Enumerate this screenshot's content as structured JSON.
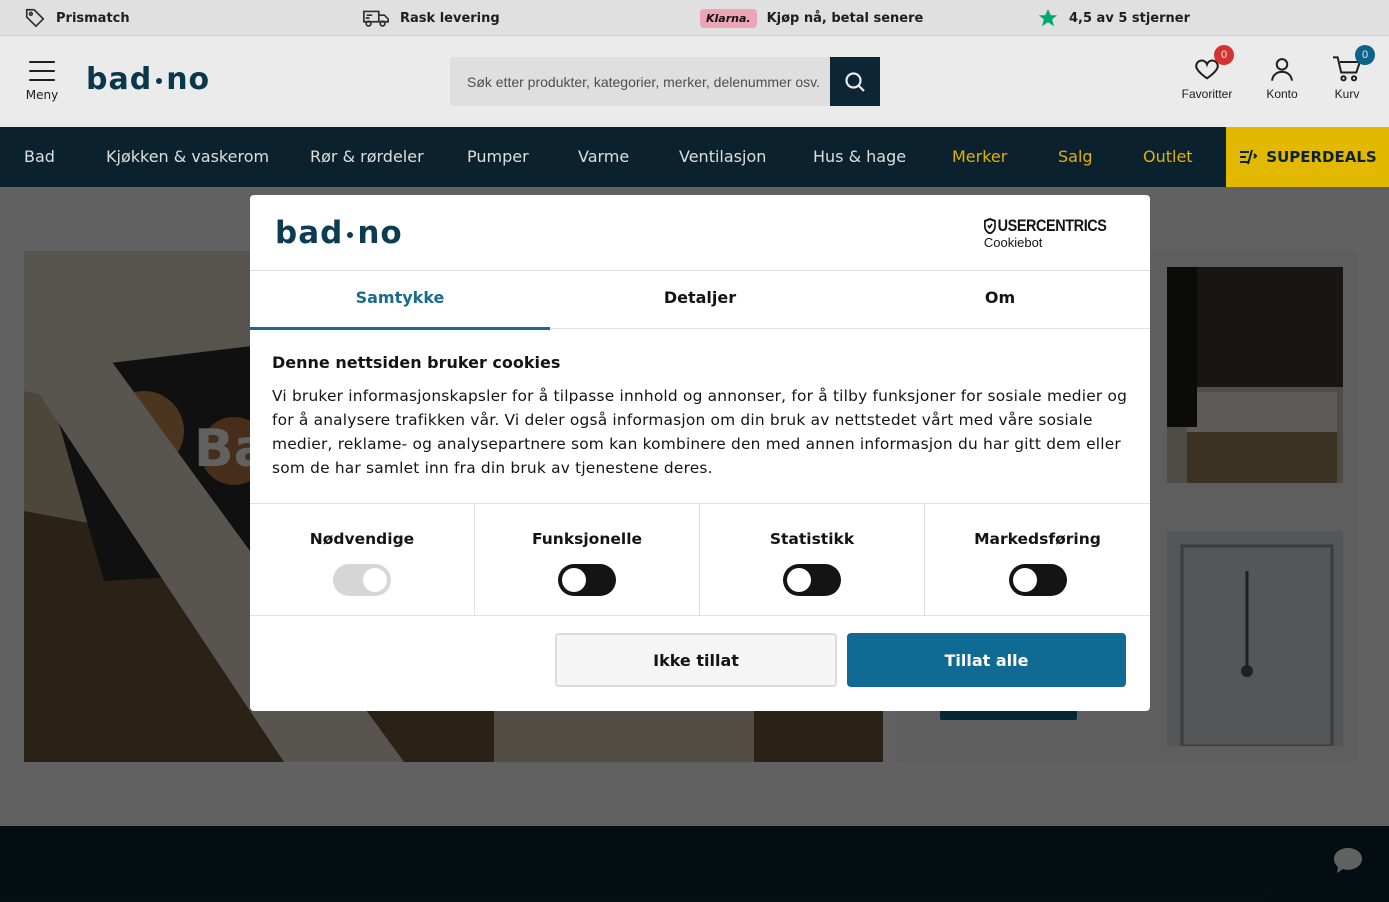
{
  "usp": [
    {
      "icon": "tag-icon",
      "label": "Prismatch"
    },
    {
      "icon": "delivery-truck-icon",
      "label": "Rask levering"
    },
    {
      "icon": "klarna-logo",
      "badge": "Klarna.",
      "label": "Kjøp nå, betal senere"
    },
    {
      "icon": "star-icon",
      "label": "4,5 av 5 stjerner"
    }
  ],
  "header": {
    "menu_label": "Meny",
    "logo": {
      "left": "bad",
      "right": "no"
    },
    "search_placeholder": "Søk etter produkter, kategorier, merker, delenummer osv.",
    "favorites": {
      "label": "Favoritter",
      "count": "0"
    },
    "account": {
      "label": "Konto"
    },
    "cart": {
      "label": "Kurv",
      "count": "0"
    }
  },
  "nav": [
    {
      "label": "Bad"
    },
    {
      "label": "Kjøkken & vaskerom"
    },
    {
      "label": "Rør & rørdeler"
    },
    {
      "label": "Pumper"
    },
    {
      "label": "Varme"
    },
    {
      "label": "Ventilasjon"
    },
    {
      "label": "Hus & hage"
    },
    {
      "label": "Merker"
    },
    {
      "label": "Salg"
    },
    {
      "label": "Outlet"
    },
    {
      "label": "SUPERDEALS"
    }
  ],
  "hero": {
    "title": "Ba"
  },
  "dialog": {
    "logo": {
      "left": "bad",
      "right": "no"
    },
    "provider": {
      "line1": "USERCENTRICS",
      "line2": "Cookiebot"
    },
    "tabs": [
      "Samtykke",
      "Detaljer",
      "Om"
    ],
    "heading": "Denne nettsiden bruker cookies",
    "text": "Vi bruker informasjonskapsler for å tilpasse innhold og annonser, for å tilby funksjoner for sosiale medier og for å analysere trafikken vår. Vi deler også informasjon om din bruk av nettstedet vårt med våre sosiale medier, reklame- og analysepartnere som kan kombinere den med annen informasjon du har gitt dem eller som de har samlet inn fra din bruk av tjenestene deres.",
    "consents": [
      {
        "label": "Nødvendige",
        "enabled": true,
        "locked": true
      },
      {
        "label": "Funksjonelle",
        "enabled": false
      },
      {
        "label": "Statistikk",
        "enabled": false
      },
      {
        "label": "Markedsføring",
        "enabled": false
      }
    ],
    "deny_label": "Ikke tillat",
    "allow_label": "Tillat alle"
  },
  "colors": {
    "brand_dark": "#0d2431",
    "brand_blue": "#0f6a94",
    "accent_yellow": "#f6c900",
    "badge_red": "#e53935",
    "badge_blue": "#0e6b96"
  }
}
